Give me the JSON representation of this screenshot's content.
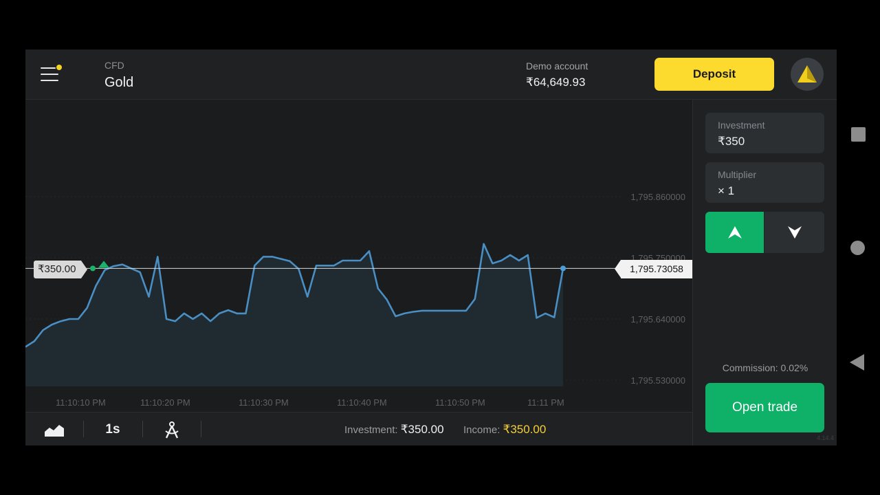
{
  "header": {
    "asset_type": "CFD",
    "asset_name": "Gold",
    "account_type": "Demo account",
    "balance": "₹64,649.93",
    "deposit_label": "Deposit",
    "menu_icon": "hamburger-menu-icon",
    "notification_dot_color": "#f5d323",
    "avatar_icon": "yellow-triangle-logo-icon"
  },
  "chart_data": {
    "type": "area",
    "y_ticks": [
      "1,795.860000",
      "1,795.750000",
      "1,795.640000",
      "1,795.530000"
    ],
    "x_ticks": [
      "11:10:10 PM",
      "11:10:20 PM",
      "11:10:30 PM",
      "11:10:40 PM",
      "11:10:50 PM",
      "11:11 PM"
    ],
    "current_price": "1,795.73058",
    "investment_marker": "₹350.00",
    "line_color": "#4a8fc4",
    "fill_color": "#1f2a31",
    "series": [
      {
        "values": [
          1795.59,
          1795.6,
          1795.62,
          1795.63,
          1795.636,
          1795.64,
          1795.64,
          1795.66,
          1795.7,
          1795.728,
          1795.735,
          1795.738,
          1795.731,
          1795.724,
          1795.68,
          1795.752,
          1795.64,
          1795.636,
          1795.65,
          1795.64,
          1795.65,
          1795.636,
          1795.65,
          1795.656,
          1795.65,
          1795.65,
          1795.736,
          1795.752,
          1795.752,
          1795.748,
          1795.744,
          1795.73,
          1795.68,
          1795.736,
          1795.736,
          1795.736,
          1795.745,
          1795.745,
          1795.745,
          1795.762,
          1795.695,
          1795.675,
          1795.645,
          1795.65,
          1795.653,
          1795.655,
          1795.655,
          1795.655,
          1795.655,
          1795.655,
          1795.655,
          1795.676,
          1795.775,
          1795.74,
          1795.745,
          1795.755,
          1795.745,
          1795.755,
          1795.642,
          1795.65,
          1795.643,
          1795.731
        ]
      }
    ]
  },
  "bottom_bar": {
    "chart_type_icon": "area-chart-icon",
    "timeframe": "1s",
    "indicators_icon": "drawing-tools-icon",
    "investment_label": "Investment:",
    "investment_value": "₹350.00",
    "income_label": "Income:",
    "income_value": "₹350.00"
  },
  "panel": {
    "investment_label": "Investment",
    "investment_value": "₹350",
    "multiplier_label": "Multiplier",
    "multiplier_value": "× 1",
    "up_icon": "arrow-up-icon",
    "down_icon": "arrow-down-icon",
    "commission": "Commission: 0.02%",
    "open_trade_label": "Open trade",
    "version": "4.14.4",
    "up_color": "#0fb067"
  }
}
